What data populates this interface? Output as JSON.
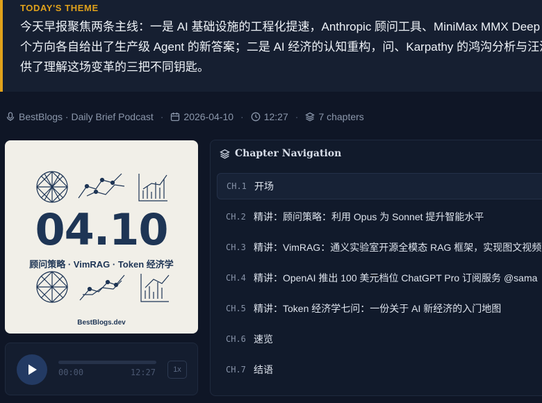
{
  "theme": {
    "label": "TODAY'S THEME",
    "text": "今天早报聚焦两条主线：一是 AI 基础设施的工程化提速，Anthropic 顾问工具、MiniMax MMX Deep Agents Deploy 三个方向各自给出了生产级 Agent 的新答案；二是 AI 经济的认知重构，问、Karpathy 的鸿沟分析与汪滔的创业反思，提供了理解这场变革的三把不同钥匙。"
  },
  "meta": {
    "source": "BestBlogs · Daily Brief Podcast",
    "date": "2026-04-10",
    "time": "12:27",
    "chapters": "7 chapters",
    "icons": [
      "microphone-icon",
      "calendar-icon",
      "clock-icon",
      "layers-icon"
    ]
  },
  "cover": {
    "date": "04.10",
    "subtitle": "顾问策略 · VimRAG · Token 经济学",
    "site": "BestBlogs.dev"
  },
  "player": {
    "current": "00:00",
    "total": "12:27",
    "speed": "1x",
    "progress": 0
  },
  "chapter_panel": {
    "title": "Chapter Navigation",
    "items": [
      {
        "num": "CH.1",
        "title": "开场"
      },
      {
        "num": "CH.2",
        "title": "精讲：顾问策略：利用 Opus 为 Sonnet 提升智能水平"
      },
      {
        "num": "CH.3",
        "title": "精讲：VimRAG：通义实验室开源全模态 RAG 框架，实现图文视频统"
      },
      {
        "num": "CH.4",
        "title": "精讲：OpenAI 推出 100 美元档位 ChatGPT Pro 订阅服务 @sama"
      },
      {
        "num": "CH.5",
        "title": "精讲：Token 经济学七问：一份关于 AI 新经济的入门地图"
      },
      {
        "num": "CH.6",
        "title": "速览"
      },
      {
        "num": "CH.7",
        "title": "结语"
      }
    ],
    "active_index": 0
  },
  "colors": {
    "accent": "#e0a11b",
    "background": "#0f1626",
    "cover_ink": "#1e3555"
  }
}
